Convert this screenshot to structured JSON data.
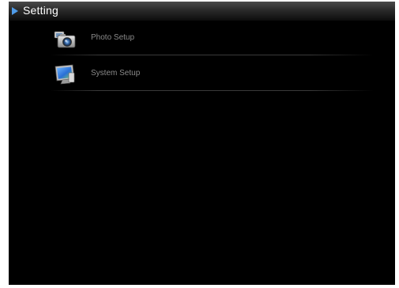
{
  "header": {
    "title": "Setting",
    "arrow_icon": "play-arrow-icon",
    "accent_color": "#4f9be8"
  },
  "menu": {
    "items": [
      {
        "label": "Photo Setup",
        "icon": "camera-icon"
      },
      {
        "label": "System Setup",
        "icon": "monitor-icon"
      }
    ]
  }
}
